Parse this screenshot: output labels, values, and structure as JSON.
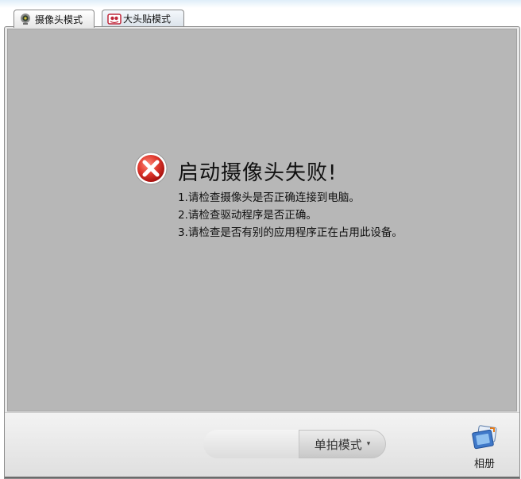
{
  "tabs": [
    {
      "label": "摄像头模式",
      "icon": "webcam-icon",
      "active": true
    },
    {
      "label": "大头贴模式",
      "icon": "photo-sticker-icon",
      "active": false
    }
  ],
  "error": {
    "icon": "error-icon",
    "title": "启动摄像头失败!",
    "lines": [
      "1.请检查摄像头是否正确连接到电脑。",
      "2.请检查驱动程序是否正确。",
      "3.请检查是否有别的应用程序正在占用此设备。"
    ]
  },
  "bottom": {
    "capture_label": "",
    "mode_label": "单拍模式",
    "mode_caret": "▾",
    "album_label": "相册",
    "album_icon": "album-icon"
  },
  "colors": {
    "viewport_bg": "#b7b7b7",
    "error_red": "#d62d2d"
  }
}
